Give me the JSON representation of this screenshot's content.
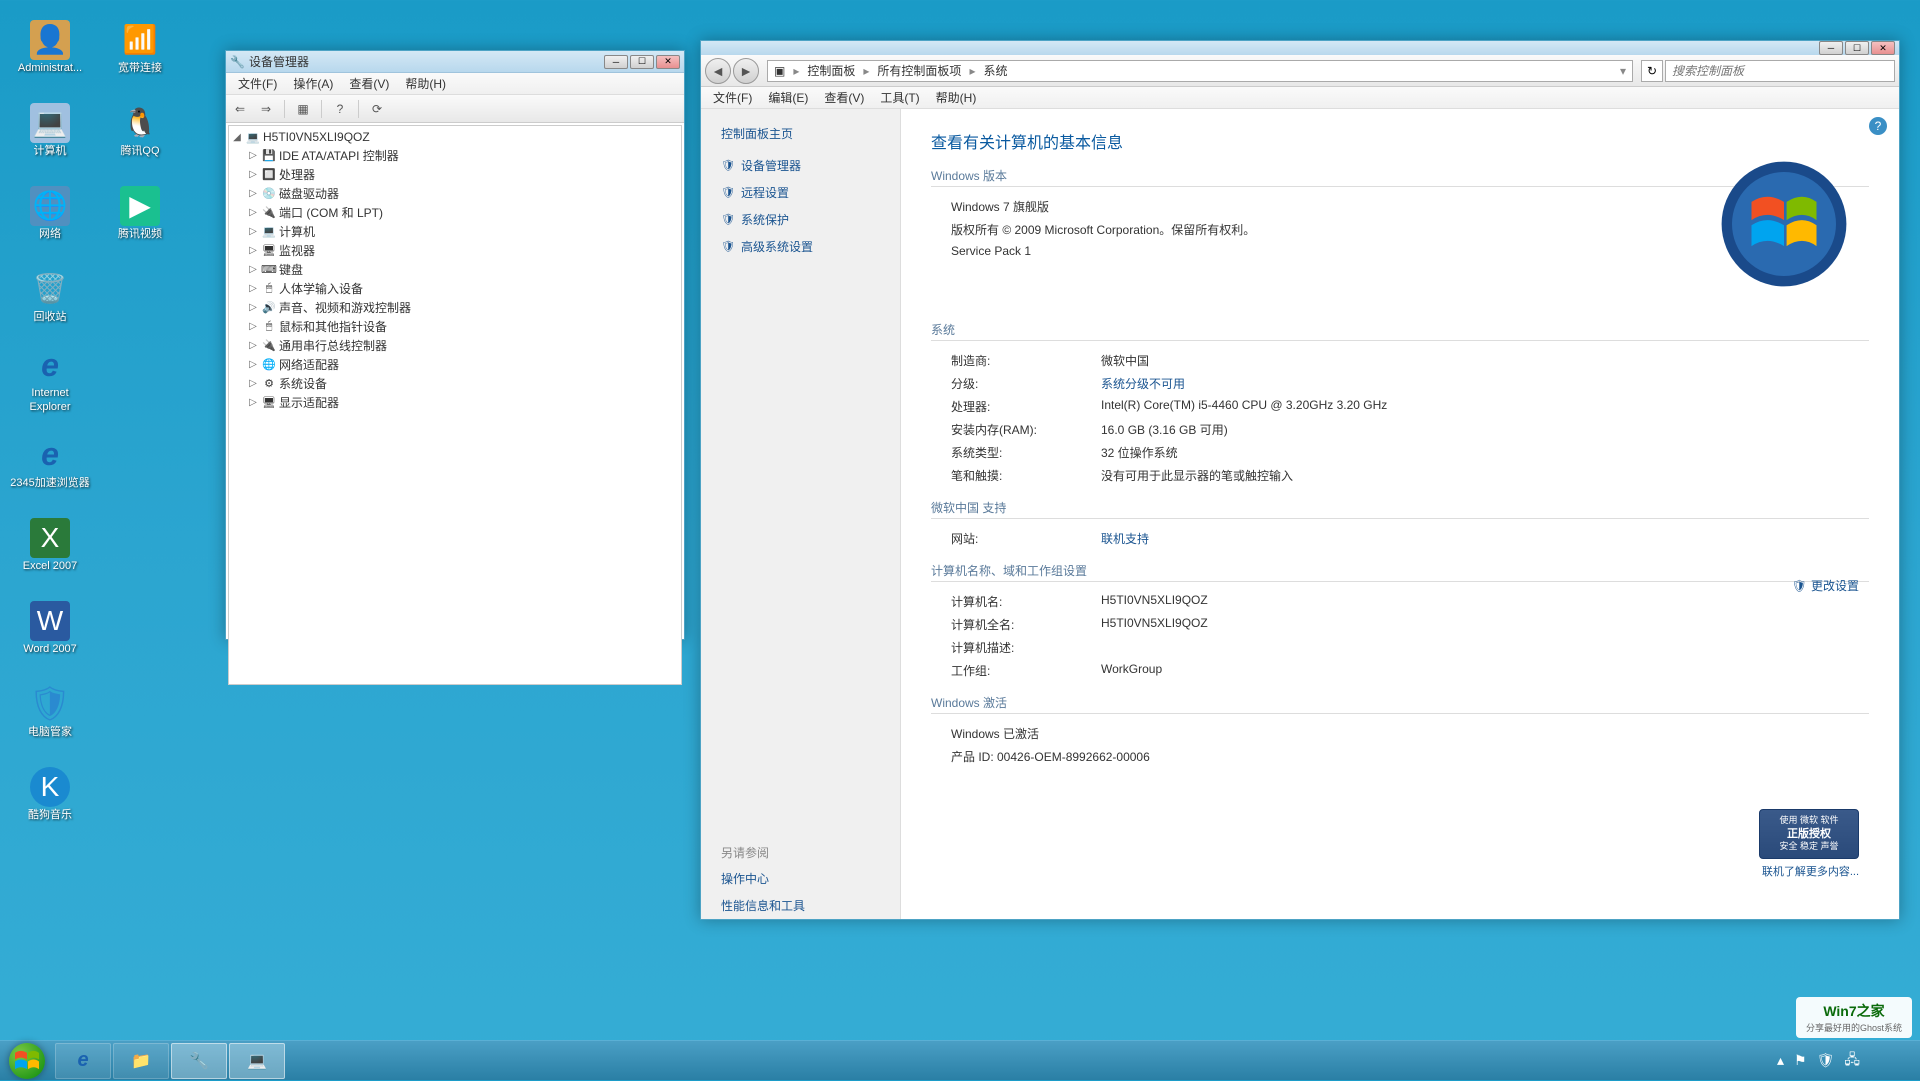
{
  "desktop": {
    "col1": [
      {
        "label": "Administrat...",
        "icon": "👤",
        "name": "admin-icon"
      },
      {
        "label": "计算机",
        "icon": "💻",
        "name": "computer-icon"
      },
      {
        "label": "网络",
        "icon": "🌐",
        "name": "network-icon"
      },
      {
        "label": "回收站",
        "icon": "🗑",
        "name": "recyclebin-icon"
      },
      {
        "label": "Internet Explorer",
        "icon": "e",
        "name": "ie-icon"
      },
      {
        "label": "2345加速浏览器",
        "icon": "e",
        "name": "2345-icon"
      },
      {
        "label": "Excel 2007",
        "icon": "X",
        "name": "excel-icon"
      },
      {
        "label": "Word 2007",
        "icon": "W",
        "name": "word-icon"
      },
      {
        "label": "电脑管家",
        "icon": "♥",
        "name": "pcmanager-icon"
      },
      {
        "label": "酷狗音乐",
        "icon": "K",
        "name": "kugou-icon"
      }
    ],
    "col2": [
      {
        "label": "宽带连接",
        "icon": "📶",
        "name": "broadband-icon"
      },
      {
        "label": "腾讯QQ",
        "icon": "🐧",
        "name": "qq-icon"
      },
      {
        "label": "腾讯视频",
        "icon": "▶",
        "name": "qqvideo-icon"
      }
    ]
  },
  "devmgr": {
    "title": "设备管理器",
    "menus": [
      "文件(F)",
      "操作(A)",
      "查看(V)",
      "帮助(H)"
    ],
    "root": "H5TI0VN5XLI9QOZ",
    "nodes": [
      "IDE ATA/ATAPI 控制器",
      "处理器",
      "磁盘驱动器",
      "端口 (COM 和 LPT)",
      "计算机",
      "监视器",
      "键盘",
      "人体学输入设备",
      "声音、视频和游戏控制器",
      "鼠标和其他指针设备",
      "通用串行总线控制器",
      "网络适配器",
      "系统设备",
      "显示适配器"
    ]
  },
  "syswin": {
    "breadcrumb": [
      "控制面板",
      "所有控制面板项",
      "系统"
    ],
    "search_placeholder": "搜索控制面板",
    "menus": [
      "文件(F)",
      "编辑(E)",
      "查看(V)",
      "工具(T)",
      "帮助(H)"
    ],
    "sidebar": {
      "title": "控制面板主页",
      "links": [
        "设备管理器",
        "远程设置",
        "系统保护",
        "高级系统设置"
      ],
      "see_also_title": "另请参阅",
      "see_also": [
        "操作中心",
        "性能信息和工具"
      ]
    },
    "heading": "查看有关计算机的基本信息",
    "edition_title": "Windows 版本",
    "edition": "Windows 7 旗舰版",
    "copyright": "版权所有 © 2009 Microsoft Corporation。保留所有权利。",
    "service_pack": "Service Pack 1",
    "system_title": "系统",
    "manufacturer_label": "制造商:",
    "manufacturer": "微软中国",
    "rating_label": "分级:",
    "rating": "系统分级不可用",
    "processor_label": "处理器:",
    "processor": "Intel(R) Core(TM) i5-4460  CPU @ 3.20GHz   3.20 GHz",
    "ram_label": "安装内存(RAM):",
    "ram": "16.0 GB (3.16 GB 可用)",
    "systype_label": "系统类型:",
    "systype": "32 位操作系统",
    "pentouch_label": "笔和触摸:",
    "pentouch": "没有可用于此显示器的笔或触控输入",
    "support_title": "微软中国 支持",
    "website_label": "网站:",
    "website_link": "联机支持",
    "computername_title": "计算机名称、域和工作组设置",
    "compname_label": "计算机名:",
    "compname": "H5TI0VN5XLI9QOZ",
    "fullname_label": "计算机全名:",
    "fullname": "H5TI0VN5XLI9QOZ",
    "desc_label": "计算机描述:",
    "desc": "",
    "workgroup_label": "工作组:",
    "workgroup": "WorkGroup",
    "change_settings": "更改设置",
    "activation_title": "Windows 激活",
    "activation_status": "Windows 已激活",
    "product_id": "产品 ID: 00426-OEM-8992662-00006",
    "activation_badge_line1": "使用 微软 软件",
    "activation_badge_line2": "正版授权",
    "activation_badge_line3": "安全 稳定 声誉",
    "activation_link": "联机了解更多内容..."
  },
  "watermark": {
    "title": "Win7之家",
    "subtitle": "分享最好用的Ghost系统"
  }
}
